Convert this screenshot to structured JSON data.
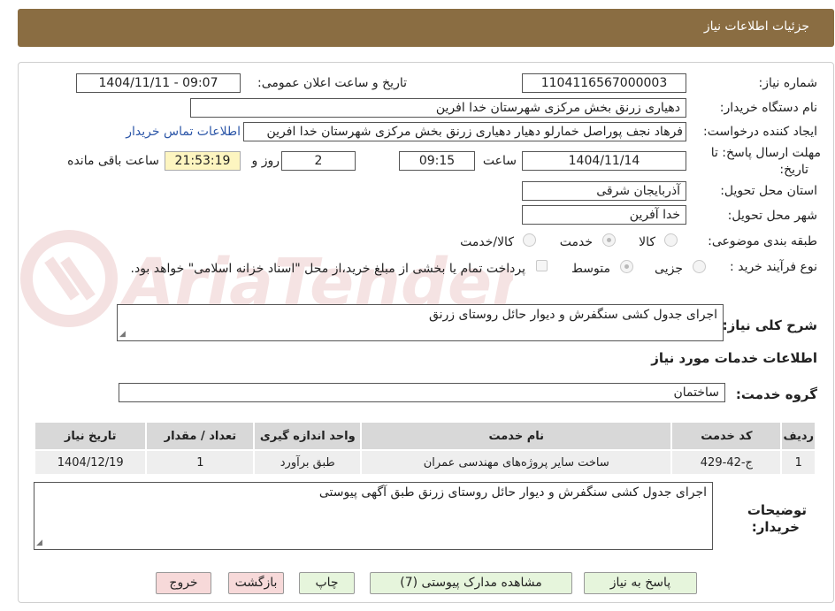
{
  "header": {
    "title": "جزئیات اطلاعات نیاز"
  },
  "form": {
    "need_number_label": "شماره نیاز:",
    "need_number": "1104116567000003",
    "announce_label": "تاریخ و ساعت اعلان عمومی:",
    "announce_value": "1404/11/11 - 09:07",
    "buyer_org_label": "نام دستگاه خریدار:",
    "buyer_org": "دهیاری زرنق بخش مرکزی شهرستان خدا افرین",
    "requester_label": "ایجاد کننده درخواست:",
    "requester": "فرهاد نجف پوراصل خمارلو دهیار دهیاری زرنق بخش مرکزی شهرستان خدا افرین",
    "contact_link": "اطلاعات تماس خریدار",
    "deadline_label_1": "مهلت ارسال پاسخ: تا",
    "deadline_label_2": "تاریخ:",
    "deadline_date": "1404/11/14",
    "hour_label": "ساعت",
    "deadline_time": "09:15",
    "days_value": "2",
    "days_label": "روز و",
    "remaining_time": "21:53:19",
    "remaining_label": "ساعت باقی مانده",
    "province_label": "استان محل تحویل:",
    "province": "آذربایجان شرقی",
    "city_label": "شهر محل تحویل:",
    "city": "خدا آفرین",
    "category_label": "طبقه بندی موضوعی:",
    "category_options": [
      "کالا",
      "خدمت",
      "کالا/خدمت"
    ],
    "process_label": "نوع فرآیند خرید :",
    "process_options": [
      "جزیی",
      "متوسط"
    ],
    "payment_note": "پرداخت تمام یا بخشی از مبلغ خرید،از محل \"اسناد خزانه اسلامی\" خواهد بود."
  },
  "summary": {
    "label": "شرح کلی نیاز:",
    "value": "اجرای جدول کشی سنگفرش و دیوار حائل روستای زرنق"
  },
  "services": {
    "section_title": "اطلاعات خدمات مورد نیاز",
    "group_label": "گروه خدمت:",
    "group_value": "ساختمان",
    "columns": [
      "ردیف",
      "کد خدمت",
      "نام خدمت",
      "واحد اندازه گیری",
      "تعداد / مقدار",
      "تاریخ نیاز"
    ],
    "rows": [
      [
        "1",
        "ج-42-429",
        "ساخت سایر پروژه‌های مهندسی عمران",
        "طبق برآورد",
        "1",
        "1404/12/19"
      ]
    ]
  },
  "buyer_notes": {
    "label_1": "توضیحات",
    "label_2": "خریدار:",
    "value": "اجرای جدول کشی سنگفرش و دیوار حائل روستای زرنق طبق آگهی پیوستی"
  },
  "buttons": {
    "reply": "پاسخ به نیاز",
    "attachments": "مشاهده مدارک پیوستی (7)",
    "print": "چاپ",
    "back": "بازگشت",
    "exit": "خروج"
  },
  "watermark_text": "AriaTender.neT",
  "colors": {
    "header_bg": "#8a6d42",
    "link": "#2d57a8",
    "remaining_bg": "#fdf5c0",
    "btn_green": "#e6f5dc",
    "btn_pink": "#f7d9d9"
  }
}
